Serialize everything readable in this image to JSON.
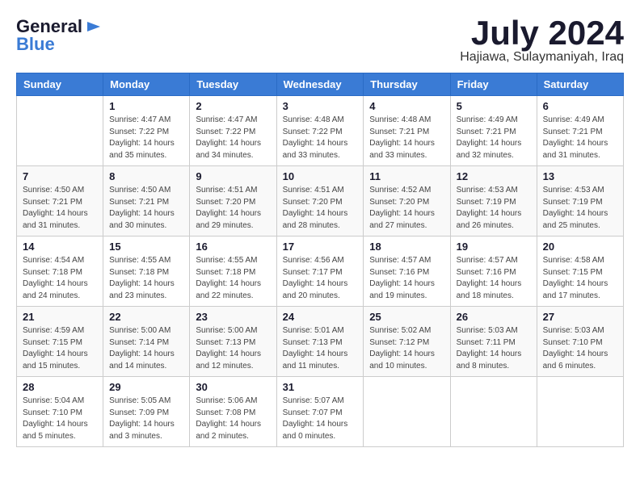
{
  "header": {
    "logo_general": "General",
    "logo_blue": "Blue",
    "month": "July 2024",
    "location": "Hajiawa, Sulaymaniyah, Iraq"
  },
  "days_of_week": [
    "Sunday",
    "Monday",
    "Tuesday",
    "Wednesday",
    "Thursday",
    "Friday",
    "Saturday"
  ],
  "weeks": [
    [
      {
        "day": "",
        "sunrise": "",
        "sunset": "",
        "daylight": ""
      },
      {
        "day": "1",
        "sunrise": "Sunrise: 4:47 AM",
        "sunset": "Sunset: 7:22 PM",
        "daylight": "Daylight: 14 hours and 35 minutes."
      },
      {
        "day": "2",
        "sunrise": "Sunrise: 4:47 AM",
        "sunset": "Sunset: 7:22 PM",
        "daylight": "Daylight: 14 hours and 34 minutes."
      },
      {
        "day": "3",
        "sunrise": "Sunrise: 4:48 AM",
        "sunset": "Sunset: 7:22 PM",
        "daylight": "Daylight: 14 hours and 33 minutes."
      },
      {
        "day": "4",
        "sunrise": "Sunrise: 4:48 AM",
        "sunset": "Sunset: 7:21 PM",
        "daylight": "Daylight: 14 hours and 33 minutes."
      },
      {
        "day": "5",
        "sunrise": "Sunrise: 4:49 AM",
        "sunset": "Sunset: 7:21 PM",
        "daylight": "Daylight: 14 hours and 32 minutes."
      },
      {
        "day": "6",
        "sunrise": "Sunrise: 4:49 AM",
        "sunset": "Sunset: 7:21 PM",
        "daylight": "Daylight: 14 hours and 31 minutes."
      }
    ],
    [
      {
        "day": "7",
        "sunrise": "Sunrise: 4:50 AM",
        "sunset": "Sunset: 7:21 PM",
        "daylight": "Daylight: 14 hours and 31 minutes."
      },
      {
        "day": "8",
        "sunrise": "Sunrise: 4:50 AM",
        "sunset": "Sunset: 7:21 PM",
        "daylight": "Daylight: 14 hours and 30 minutes."
      },
      {
        "day": "9",
        "sunrise": "Sunrise: 4:51 AM",
        "sunset": "Sunset: 7:20 PM",
        "daylight": "Daylight: 14 hours and 29 minutes."
      },
      {
        "day": "10",
        "sunrise": "Sunrise: 4:51 AM",
        "sunset": "Sunset: 7:20 PM",
        "daylight": "Daylight: 14 hours and 28 minutes."
      },
      {
        "day": "11",
        "sunrise": "Sunrise: 4:52 AM",
        "sunset": "Sunset: 7:20 PM",
        "daylight": "Daylight: 14 hours and 27 minutes."
      },
      {
        "day": "12",
        "sunrise": "Sunrise: 4:53 AM",
        "sunset": "Sunset: 7:19 PM",
        "daylight": "Daylight: 14 hours and 26 minutes."
      },
      {
        "day": "13",
        "sunrise": "Sunrise: 4:53 AM",
        "sunset": "Sunset: 7:19 PM",
        "daylight": "Daylight: 14 hours and 25 minutes."
      }
    ],
    [
      {
        "day": "14",
        "sunrise": "Sunrise: 4:54 AM",
        "sunset": "Sunset: 7:18 PM",
        "daylight": "Daylight: 14 hours and 24 minutes."
      },
      {
        "day": "15",
        "sunrise": "Sunrise: 4:55 AM",
        "sunset": "Sunset: 7:18 PM",
        "daylight": "Daylight: 14 hours and 23 minutes."
      },
      {
        "day": "16",
        "sunrise": "Sunrise: 4:55 AM",
        "sunset": "Sunset: 7:18 PM",
        "daylight": "Daylight: 14 hours and 22 minutes."
      },
      {
        "day": "17",
        "sunrise": "Sunrise: 4:56 AM",
        "sunset": "Sunset: 7:17 PM",
        "daylight": "Daylight: 14 hours and 20 minutes."
      },
      {
        "day": "18",
        "sunrise": "Sunrise: 4:57 AM",
        "sunset": "Sunset: 7:16 PM",
        "daylight": "Daylight: 14 hours and 19 minutes."
      },
      {
        "day": "19",
        "sunrise": "Sunrise: 4:57 AM",
        "sunset": "Sunset: 7:16 PM",
        "daylight": "Daylight: 14 hours and 18 minutes."
      },
      {
        "day": "20",
        "sunrise": "Sunrise: 4:58 AM",
        "sunset": "Sunset: 7:15 PM",
        "daylight": "Daylight: 14 hours and 17 minutes."
      }
    ],
    [
      {
        "day": "21",
        "sunrise": "Sunrise: 4:59 AM",
        "sunset": "Sunset: 7:15 PM",
        "daylight": "Daylight: 14 hours and 15 minutes."
      },
      {
        "day": "22",
        "sunrise": "Sunrise: 5:00 AM",
        "sunset": "Sunset: 7:14 PM",
        "daylight": "Daylight: 14 hours and 14 minutes."
      },
      {
        "day": "23",
        "sunrise": "Sunrise: 5:00 AM",
        "sunset": "Sunset: 7:13 PM",
        "daylight": "Daylight: 14 hours and 12 minutes."
      },
      {
        "day": "24",
        "sunrise": "Sunrise: 5:01 AM",
        "sunset": "Sunset: 7:13 PM",
        "daylight": "Daylight: 14 hours and 11 minutes."
      },
      {
        "day": "25",
        "sunrise": "Sunrise: 5:02 AM",
        "sunset": "Sunset: 7:12 PM",
        "daylight": "Daylight: 14 hours and 10 minutes."
      },
      {
        "day": "26",
        "sunrise": "Sunrise: 5:03 AM",
        "sunset": "Sunset: 7:11 PM",
        "daylight": "Daylight: 14 hours and 8 minutes."
      },
      {
        "day": "27",
        "sunrise": "Sunrise: 5:03 AM",
        "sunset": "Sunset: 7:10 PM",
        "daylight": "Daylight: 14 hours and 6 minutes."
      }
    ],
    [
      {
        "day": "28",
        "sunrise": "Sunrise: 5:04 AM",
        "sunset": "Sunset: 7:10 PM",
        "daylight": "Daylight: 14 hours and 5 minutes."
      },
      {
        "day": "29",
        "sunrise": "Sunrise: 5:05 AM",
        "sunset": "Sunset: 7:09 PM",
        "daylight": "Daylight: 14 hours and 3 minutes."
      },
      {
        "day": "30",
        "sunrise": "Sunrise: 5:06 AM",
        "sunset": "Sunset: 7:08 PM",
        "daylight": "Daylight: 14 hours and 2 minutes."
      },
      {
        "day": "31",
        "sunrise": "Sunrise: 5:07 AM",
        "sunset": "Sunset: 7:07 PM",
        "daylight": "Daylight: 14 hours and 0 minutes."
      },
      {
        "day": "",
        "sunrise": "",
        "sunset": "",
        "daylight": ""
      },
      {
        "day": "",
        "sunrise": "",
        "sunset": "",
        "daylight": ""
      },
      {
        "day": "",
        "sunrise": "",
        "sunset": "",
        "daylight": ""
      }
    ]
  ]
}
